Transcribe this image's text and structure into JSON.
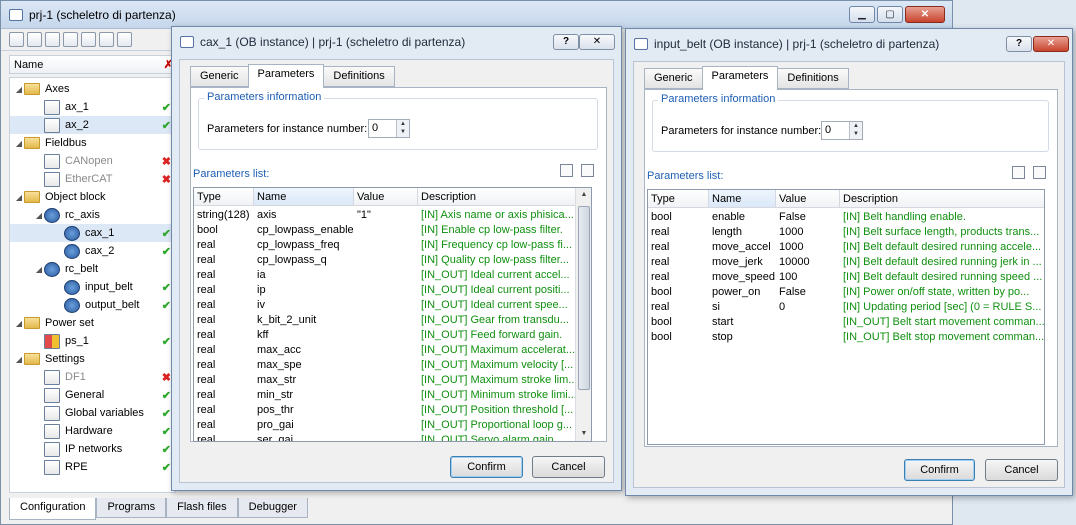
{
  "main": {
    "title": "prj-1 (scheletro di partenza)",
    "tree_header": "Name",
    "tree": [
      {
        "label": "Axes",
        "kind": "folder",
        "level": 0,
        "status": ""
      },
      {
        "label": "ax_1",
        "kind": "doc",
        "level": 1,
        "status": "ok"
      },
      {
        "label": "ax_2",
        "kind": "doc",
        "level": 1,
        "status": "ok",
        "selected": true
      },
      {
        "label": "Fieldbus",
        "kind": "folder",
        "level": 0,
        "status": ""
      },
      {
        "label": "CANopen",
        "kind": "doc",
        "level": 1,
        "status": "err",
        "disabled": true
      },
      {
        "label": "EtherCAT",
        "kind": "doc",
        "level": 1,
        "status": "err",
        "disabled": true
      },
      {
        "label": "Object block",
        "kind": "folder",
        "level": 0,
        "status": ""
      },
      {
        "label": "rc_axis",
        "kind": "gears",
        "level": 1,
        "status": ""
      },
      {
        "label": "cax_1",
        "kind": "gears",
        "level": 2,
        "status": "ok",
        "selected": true
      },
      {
        "label": "cax_2",
        "kind": "gears",
        "level": 2,
        "status": "ok"
      },
      {
        "label": "rc_belt",
        "kind": "gears",
        "level": 1,
        "status": ""
      },
      {
        "label": "input_belt",
        "kind": "gears",
        "level": 2,
        "status": "ok"
      },
      {
        "label": "output_belt",
        "kind": "gears",
        "level": 2,
        "status": "ok"
      },
      {
        "label": "Power set",
        "kind": "folder",
        "level": 0,
        "status": ""
      },
      {
        "label": "ps_1",
        "kind": "grid",
        "level": 1,
        "status": "ok"
      },
      {
        "label": "Settings",
        "kind": "folder",
        "level": 0,
        "status": ""
      },
      {
        "label": "DF1",
        "kind": "doc",
        "level": 1,
        "status": "err",
        "disabled": true
      },
      {
        "label": "General",
        "kind": "doc",
        "level": 1,
        "status": "ok"
      },
      {
        "label": "Global variables",
        "kind": "doc",
        "level": 1,
        "status": "ok"
      },
      {
        "label": "Hardware",
        "kind": "doc",
        "level": 1,
        "status": "ok"
      },
      {
        "label": "IP networks",
        "kind": "doc",
        "level": 1,
        "status": "ok"
      },
      {
        "label": "RPE",
        "kind": "doc",
        "level": 1,
        "status": "ok"
      }
    ],
    "bottom_tabs": [
      "Configuration",
      "Programs",
      "Flash files",
      "Debugger"
    ]
  },
  "dialog1": {
    "title": "cax_1 (OB instance) | prj-1 (scheletro di partenza)",
    "help": "?",
    "tabs": [
      "Generic",
      "Parameters",
      "Definitions"
    ],
    "group_label": "Parameters information",
    "instance_label": "Parameters for instance number:",
    "instance_value": "0",
    "list_label": "Parameters list:",
    "columns": [
      "Type",
      "Name",
      "Value",
      "Description"
    ],
    "rows": [
      [
        "string(128)",
        "axis",
        "\"1\"",
        "[IN] Axis name or axis phisica..."
      ],
      [
        "bool",
        "cp_lowpass_enable",
        "",
        "[IN] Enable cp low-pass filter."
      ],
      [
        "real",
        "cp_lowpass_freq",
        "",
        "[IN] Frequency cp low-pass fi..."
      ],
      [
        "real",
        "cp_lowpass_q",
        "",
        "[IN] Quality cp low-pass filter..."
      ],
      [
        "real",
        "ia",
        "",
        "[IN_OUT] Ideal current accel..."
      ],
      [
        "real",
        "ip",
        "",
        "[IN_OUT] Ideal current positi..."
      ],
      [
        "real",
        "iv",
        "",
        "[IN_OUT] Ideal current spee..."
      ],
      [
        "real",
        "k_bit_2_unit",
        "",
        "[IN_OUT] Gear from transdu..."
      ],
      [
        "real",
        "kff",
        "",
        "[IN_OUT] Feed forward gain."
      ],
      [
        "real",
        "max_acc",
        "",
        "[IN_OUT] Maximum accelerat..."
      ],
      [
        "real",
        "max_spe",
        "",
        "[IN_OUT] Maximum velocity [..."
      ],
      [
        "real",
        "max_str",
        "",
        "[IN_OUT] Maximum stroke lim..."
      ],
      [
        "real",
        "min_str",
        "",
        "[IN_OUT] Minimum stroke limi..."
      ],
      [
        "real",
        "pos_thr",
        "",
        "[IN_OUT] Position threshold [..."
      ],
      [
        "real",
        "pro_gai",
        "",
        "[IN_OUT] Proportional loop g..."
      ],
      [
        "real",
        "ser_gai",
        "",
        "[IN_OUT] Servo alarm gain..."
      ]
    ],
    "confirm": "Confirm",
    "cancel": "Cancel"
  },
  "dialog2": {
    "title": "input_belt (OB instance) | prj-1 (scheletro di partenza)",
    "help": "?",
    "tabs": [
      "Generic",
      "Parameters",
      "Definitions"
    ],
    "group_label": "Parameters information",
    "instance_label": "Parameters for instance number:",
    "instance_value": "0",
    "list_label": "Parameters list:",
    "columns": [
      "Type",
      "Name",
      "Value",
      "Description"
    ],
    "rows": [
      [
        "bool",
        "enable",
        "False",
        "[IN] Belt handling enable."
      ],
      [
        "real",
        "length",
        "1000",
        "[IN] Belt surface length, products trans..."
      ],
      [
        "real",
        "move_accel",
        "1000",
        "[IN] Belt default desired running accele..."
      ],
      [
        "real",
        "move_jerk",
        "10000",
        "[IN] Belt default desired running jerk in ..."
      ],
      [
        "real",
        "move_speed",
        "100",
        "[IN] Belt default desired running speed ..."
      ],
      [
        "bool",
        "power_on",
        "False",
        "[IN] Power on/off state, written by po..."
      ],
      [
        "real",
        "si",
        "0",
        "[IN] Updating period [sec] (0 = RULE S..."
      ],
      [
        "bool",
        "start",
        "",
        "[IN_OUT] Belt start movement comman..."
      ],
      [
        "bool",
        "stop",
        "",
        "[IN_OUT] Belt stop movement comman..."
      ]
    ],
    "confirm": "Confirm",
    "cancel": "Cancel"
  }
}
